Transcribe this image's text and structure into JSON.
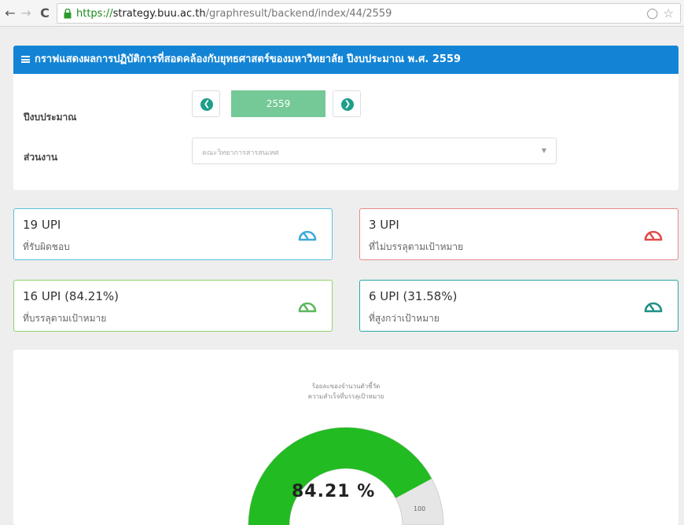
{
  "browser": {
    "url_scheme": "https://",
    "url_host": "strategy.buu.ac.th",
    "url_path": "/graphresult/backend/index/44/2559"
  },
  "panel": {
    "title": "กราฟแสดงผลการปฏิบัติการที่สอดคล้องกับยุทธศาสตร์ของมหาวิทยาลัย ปีงบประมาณ พ.ศ. 2559",
    "year_label": "ปีงบประมาณ",
    "year_value": "2559",
    "unit_label": "ส่วนงาน",
    "unit_value": "คณะวิทยาการสารสนเทศ"
  },
  "cards": [
    {
      "big": "19 UPI",
      "sub": "ที่รับผิดชอบ",
      "color": "#3fa9d6"
    },
    {
      "big": "3 UPI",
      "sub": "ที่ไม่บรรลุตามเป้าหมาย",
      "color": "#e04a4a"
    },
    {
      "big": "16 UPI (84.21%)",
      "sub": "ที่บรรลุตามเป้าหมาย",
      "color": "#5cb85c"
    },
    {
      "big": "6 UPI (31.58%)",
      "sub": "ที่สูงกว่าเป้าหมาย",
      "color": "#1f8f88"
    }
  ],
  "gauge": {
    "title_line1": "ร้อยละของจำนวนตัวชี้วัด",
    "title_line2": "ความสำเร็จที่บรรลุเป้าหมาย",
    "value": 84.21,
    "value_text": "84.21 %",
    "max_label": "100",
    "color": "#22bb22"
  }
}
